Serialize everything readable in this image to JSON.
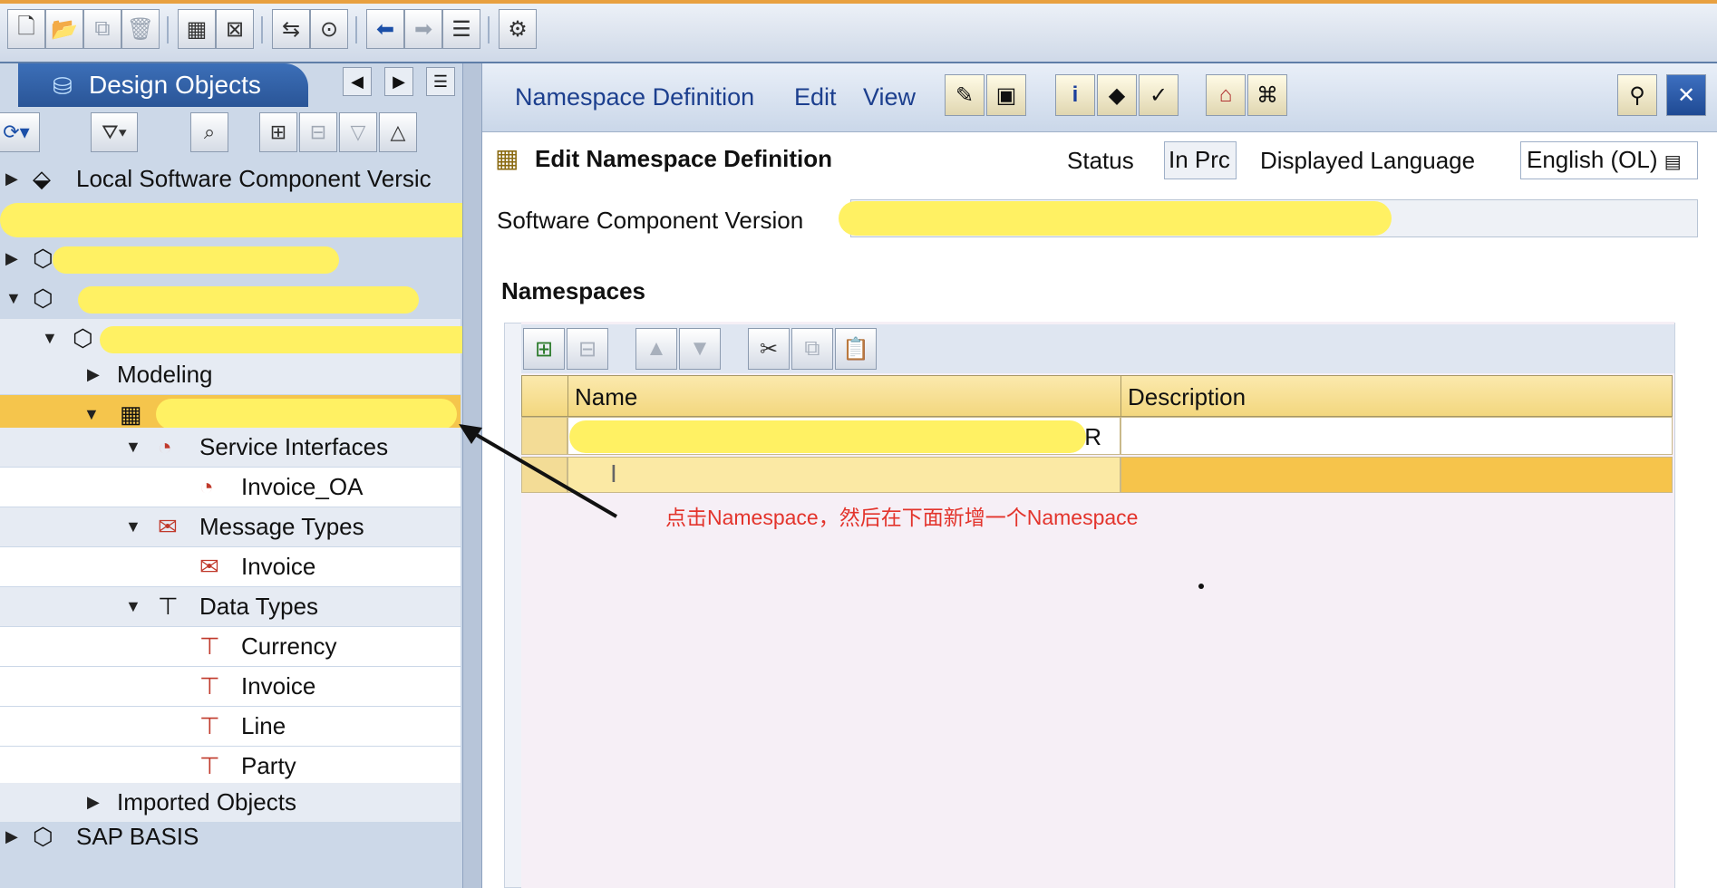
{
  "toolbar": {
    "buttons": [
      {
        "name": "new-icon",
        "glyph": "🗋"
      },
      {
        "name": "open-icon",
        "glyph": "📂"
      },
      {
        "name": "copy-icon",
        "glyph": "⧉"
      },
      {
        "name": "delete-icon",
        "glyph": "🗑"
      },
      {
        "name": "save-all-icon",
        "glyph": "▦"
      },
      {
        "name": "close-all-icon",
        "glyph": "⊠"
      },
      {
        "name": "transport-icon",
        "glyph": "⇆"
      },
      {
        "name": "where-used-icon",
        "glyph": "⊙"
      },
      {
        "name": "back-icon",
        "glyph": "⬅"
      },
      {
        "name": "forward-icon",
        "glyph": "➡"
      },
      {
        "name": "list-icon",
        "glyph": "☰"
      },
      {
        "name": "settings-icon",
        "glyph": "⚙"
      }
    ]
  },
  "left_panel": {
    "tab_label": "Design Objects",
    "tab_icon": "cylinder-icon",
    "tree": [
      {
        "label": "Local Software Component Versic",
        "icon": "software-component-icon",
        "redacted": false
      },
      {
        "label": "",
        "icon": "cube-icon",
        "redacted": true
      },
      {
        "label": "",
        "icon": "cube-icon",
        "redacted": true
      },
      {
        "label": "",
        "icon": "cube-icon",
        "redacted": true
      },
      {
        "label": "",
        "icon": "cube-clock-icon",
        "redacted": true
      },
      {
        "label": "Modeling",
        "icon": "",
        "redacted": false
      },
      {
        "label": "",
        "icon": "namespace-icon",
        "redacted": true
      },
      {
        "label": "Service Interfaces",
        "icon": "service-interface-icon",
        "redacted": false
      },
      {
        "label": "Invoice_OA",
        "icon": "service-interface-icon",
        "redacted": false
      },
      {
        "label": "Message Types",
        "icon": "message-type-icon",
        "redacted": false
      },
      {
        "label": "Invoice",
        "icon": "message-type-icon",
        "redacted": false
      },
      {
        "label": "Data Types",
        "icon": "data-type-icon",
        "redacted": false
      },
      {
        "label": "Currency",
        "icon": "data-type-icon",
        "redacted": false
      },
      {
        "label": "Invoice",
        "icon": "data-type-icon",
        "redacted": false
      },
      {
        "label": "Line",
        "icon": "data-type-icon",
        "redacted": false
      },
      {
        "label": "Party",
        "icon": "data-type-icon",
        "redacted": false
      },
      {
        "label": "Imported Objects",
        "icon": "",
        "redacted": false
      },
      {
        "label": "SAP BASIS",
        "icon": "cube-icon",
        "redacted": false
      }
    ]
  },
  "editor": {
    "menu": [
      "Namespace Definition",
      "Edit",
      "View"
    ],
    "title": "Edit Namespace Definition",
    "status_label": "Status",
    "status_value": "In Prc",
    "language_label": "Displayed Language",
    "language_value": "English (OL)",
    "scv_label": "Software Component Version",
    "namespaces_title": "Namespaces",
    "columns": [
      "Name",
      "Description"
    ],
    "rows": [
      {
        "name": "",
        "name_tail": "R",
        "description": ""
      },
      {
        "name": "",
        "name_tail": "",
        "description": ""
      }
    ]
  },
  "annotation": {
    "text": "点击Namespace，然后在下面新增一个Namespace",
    "color": "#e3342c"
  },
  "colors": {
    "header_row": "#f3d77e",
    "selected_row": "#f6c44b",
    "highlight": "#fff163",
    "menu_text": "#1c3f8e"
  }
}
